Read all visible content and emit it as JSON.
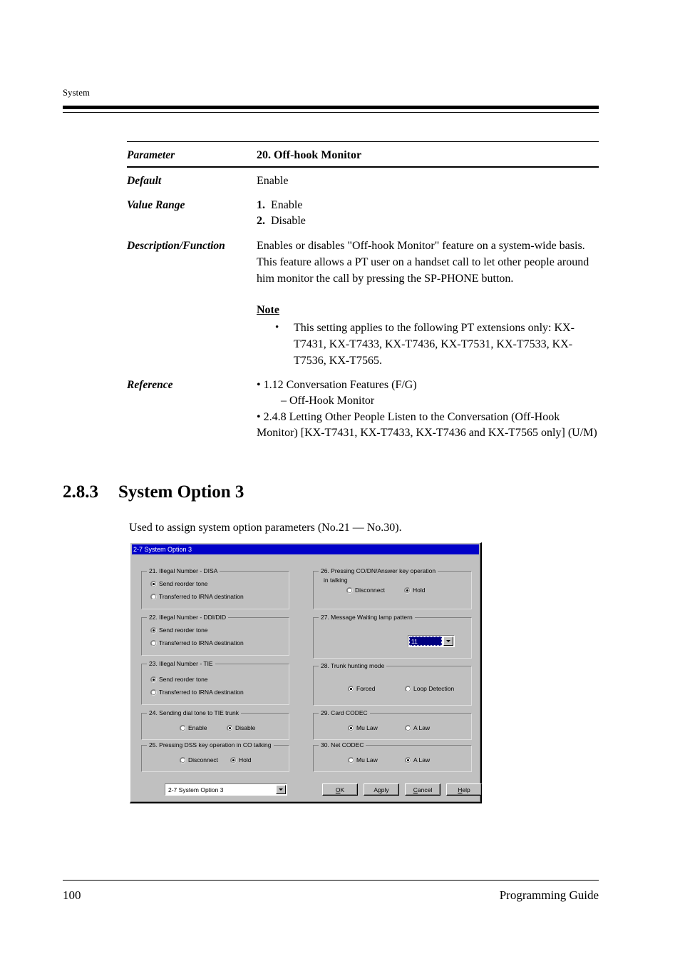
{
  "page": {
    "running_head": "System",
    "footer_page_number": "100",
    "footer_title": "Programming Guide"
  },
  "parameter_table": {
    "rows": [
      {
        "label": "Parameter",
        "value": "20. Off-hook Monitor"
      },
      {
        "label": "Default",
        "value": "Enable"
      }
    ],
    "value_range": {
      "label": "Value Range",
      "items": [
        {
          "num": "1.",
          "text": "Enable"
        },
        {
          "num": "2.",
          "text": "Disable"
        }
      ]
    },
    "description": {
      "label": "Description/Function",
      "paragraph": "Enables or disables \"Off-hook Monitor\" feature on a system-wide basis. This feature allows a PT user on a handset call to let other people around him monitor the call by pressing the SP-PHONE button.",
      "note_heading": "Note",
      "note_bullet": "•",
      "note_text": "This setting applies to the following PT extensions only: KX-T7431, KX-T7433, KX-T7436, KX-T7531, KX-T7533, KX-T7536, KX-T7565."
    },
    "reference": {
      "label": "Reference",
      "line1": "• 1.12 Conversation Features (F/G)",
      "line2": "– Off-Hook Monitor",
      "line3": "• 2.4.8 Letting Other People Listen to the Conversation (Off-Hook Monitor) [KX-T7431, KX-T7433, KX-T7436 and KX-T7565 only] (U/M)"
    }
  },
  "section": {
    "number": "2.8.3",
    "title": "System Option 3",
    "intro": "Used to assign system option parameters (No.21 — No.30)."
  },
  "dialog": {
    "title": "2-7 System Option 3",
    "groups": {
      "g21": {
        "title": "21. Illegal Number - DISA",
        "options": [
          {
            "label": "Send reorder tone",
            "selected": true
          },
          {
            "label": "Transferred to IRNA destination",
            "selected": false
          }
        ]
      },
      "g22": {
        "title": "22. Illegal Number - DDI/DID",
        "options": [
          {
            "label": "Send reorder tone",
            "selected": true
          },
          {
            "label": "Transferred to IRNA destination",
            "selected": false
          }
        ]
      },
      "g23": {
        "title": "23. Illegal Number - TIE",
        "options": [
          {
            "label": "Send reorder tone",
            "selected": true
          },
          {
            "label": "Transferred to IRNA destination",
            "selected": false
          }
        ]
      },
      "g24": {
        "title": "24. Sending dial tone to TIE trunk",
        "options": [
          {
            "label": "Enable",
            "selected": false
          },
          {
            "label": "Disable",
            "selected": true
          }
        ]
      },
      "g25": {
        "title": "25. Pressing DSS key operation in CO talking",
        "options": [
          {
            "label": "Disconnect",
            "selected": false
          },
          {
            "label": "Hold",
            "selected": true
          }
        ]
      },
      "g26": {
        "title": "26. Pressing CO/DN/Answer key operation",
        "title_line2": "in talking",
        "options": [
          {
            "label": "Disconnect",
            "selected": false
          },
          {
            "label": "Hold",
            "selected": true
          }
        ]
      },
      "g27": {
        "title": "27. Message Waiting lamp pattern",
        "combo_value": "11"
      },
      "g28": {
        "title": "28. Trunk hunting mode",
        "options": [
          {
            "label": "Forced",
            "selected": true
          },
          {
            "label": "Loop Detection",
            "selected": false
          }
        ]
      },
      "g29": {
        "title": "29. Card CODEC",
        "options": [
          {
            "label": "Mu Law",
            "selected": true
          },
          {
            "label": "A Law",
            "selected": false
          }
        ]
      },
      "g30": {
        "title": "30. Net CODEC",
        "options": [
          {
            "label": "Mu Law",
            "selected": false
          },
          {
            "label": "A Law",
            "selected": true
          }
        ]
      }
    },
    "screen_selector": "2-7 System Option 3",
    "buttons": {
      "ok": {
        "pre": "",
        "acc": "O",
        "post": "K"
      },
      "apply": {
        "pre": "A",
        "acc": "p",
        "post": "ply"
      },
      "cancel": {
        "pre": "",
        "acc": "C",
        "post": "ancel"
      },
      "help": {
        "pre": "",
        "acc": "H",
        "post": "elp"
      }
    },
    "colors": {
      "face": "#c0c0c0",
      "titlebar": "#0000c8",
      "selection": "#000080"
    }
  }
}
